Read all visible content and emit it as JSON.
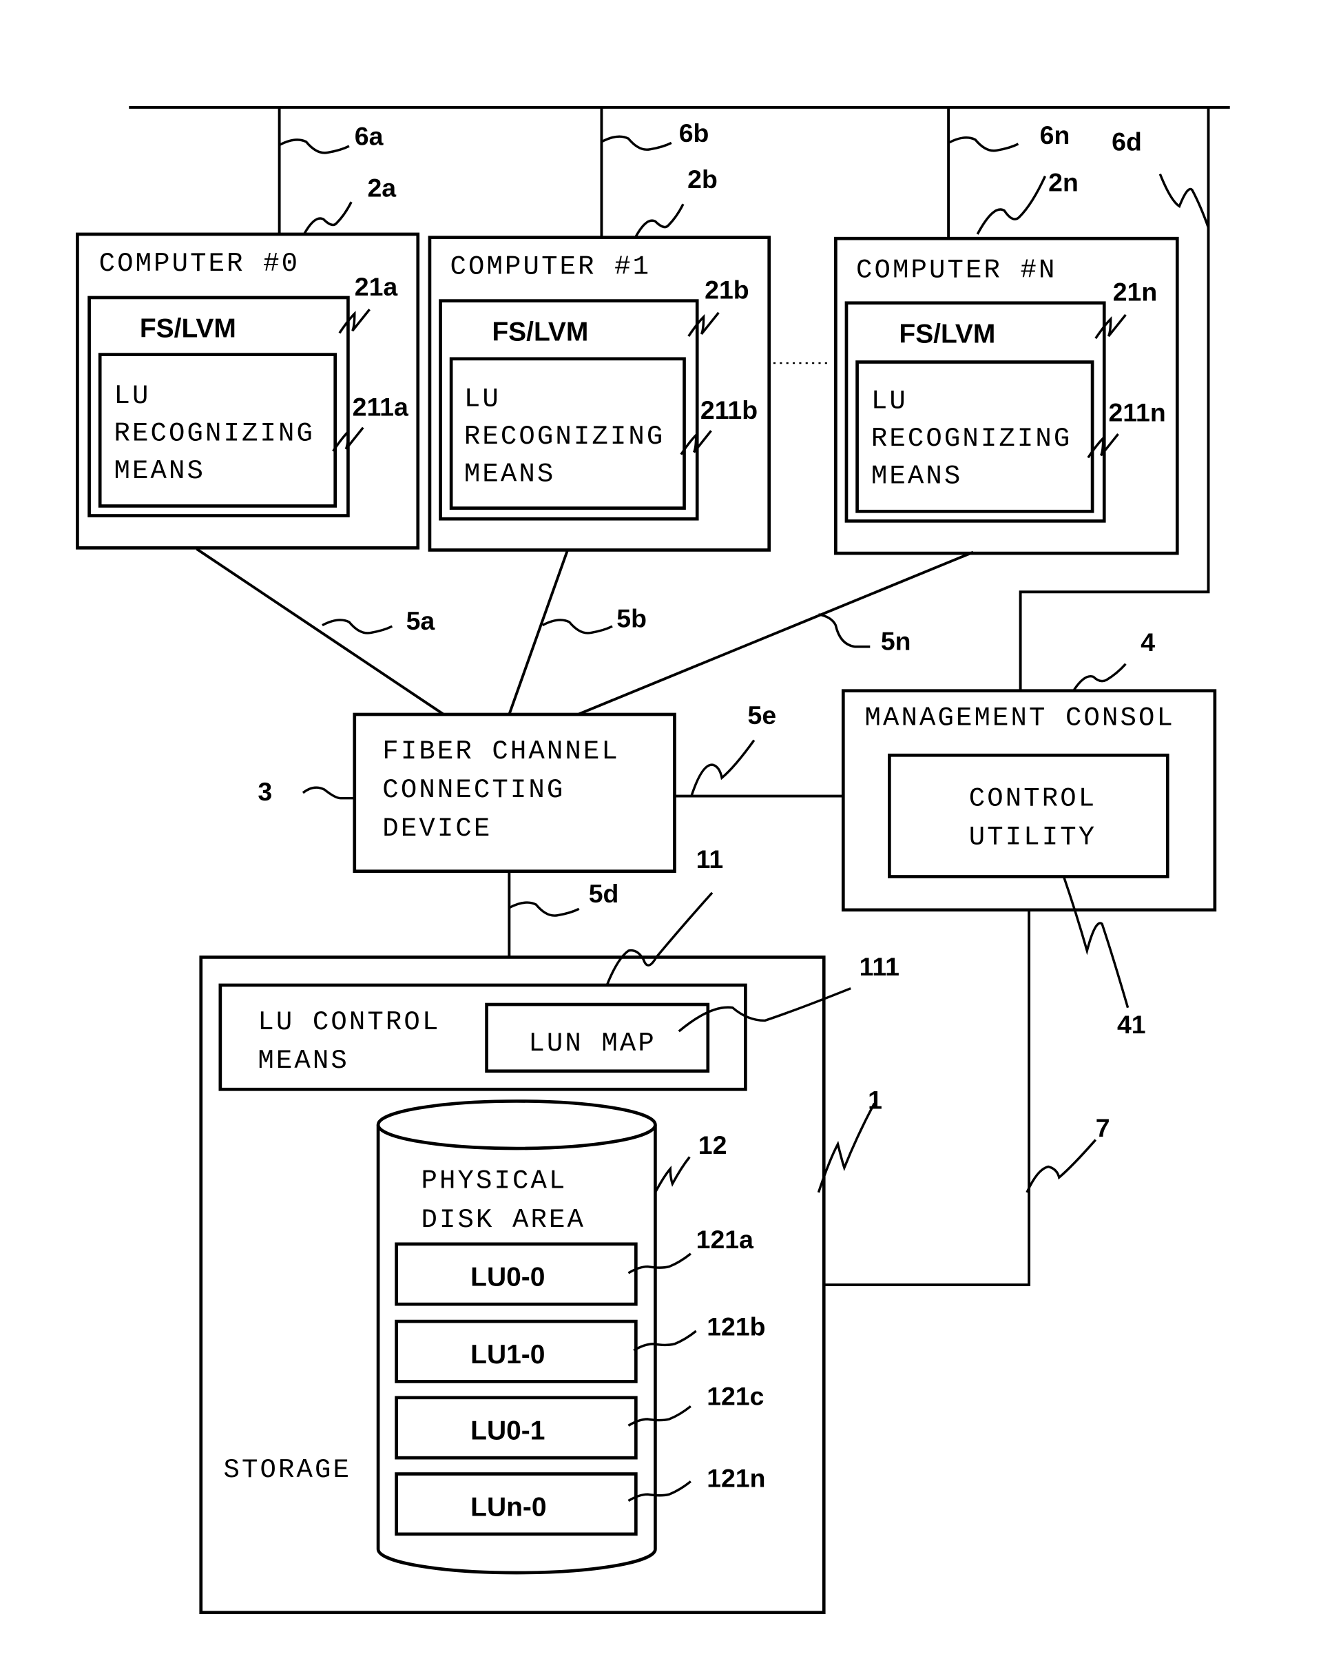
{
  "computers": [
    {
      "title": "COMPUTER #0",
      "fs": "FS/LVM",
      "lu": [
        "LU",
        "RECOGNIZING",
        "MEANS"
      ],
      "ref_box": "2a",
      "ref_fs": "21a",
      "ref_lu": "211a",
      "ref_net": "6a",
      "ref_fc": "5a"
    },
    {
      "title": "COMPUTER #1",
      "fs": "FS/LVM",
      "lu": [
        "LU",
        "RECOGNIZING",
        "MEANS"
      ],
      "ref_box": "2b",
      "ref_fs": "21b",
      "ref_lu": "211b",
      "ref_net": "6b",
      "ref_fc": "5b"
    },
    {
      "title": "COMPUTER #N",
      "fs": "FS/LVM",
      "lu": [
        "LU",
        "RECOGNIZING",
        "MEANS"
      ],
      "ref_box": "2n",
      "ref_fs": "21n",
      "ref_lu": "211n",
      "ref_net": "6n",
      "ref_fc": "5n"
    }
  ],
  "network": {
    "ref_console": "6d"
  },
  "fc_device": {
    "lines": [
      "FIBER CHANNEL",
      "CONNECTING",
      "DEVICE"
    ],
    "ref": "3",
    "ref_storage_link": "5d",
    "ref_console_link": "5e"
  },
  "console": {
    "title": "MANAGEMENT CONSOL",
    "utility": [
      "CONTROL",
      "UTILITY"
    ],
    "ref": "4",
    "ref_utility": "41",
    "ref_storage_link": "7"
  },
  "storage": {
    "label": "STORAGE",
    "ref": "1",
    "lu_control": {
      "lines": [
        "LU CONTROL",
        "MEANS"
      ],
      "ref": "11",
      "lun_map": "LUN MAP",
      "ref_lun_map": "111"
    },
    "disk": {
      "lines": [
        "PHYSICAL",
        "DISK AREA"
      ],
      "ref": "12"
    },
    "lus": [
      {
        "label": "LU0-0",
        "ref": "121a"
      },
      {
        "label": "LU1-0",
        "ref": "121b"
      },
      {
        "label": "LU0-1",
        "ref": "121c"
      },
      {
        "label": "LUn-0",
        "ref": "121n"
      }
    ]
  }
}
